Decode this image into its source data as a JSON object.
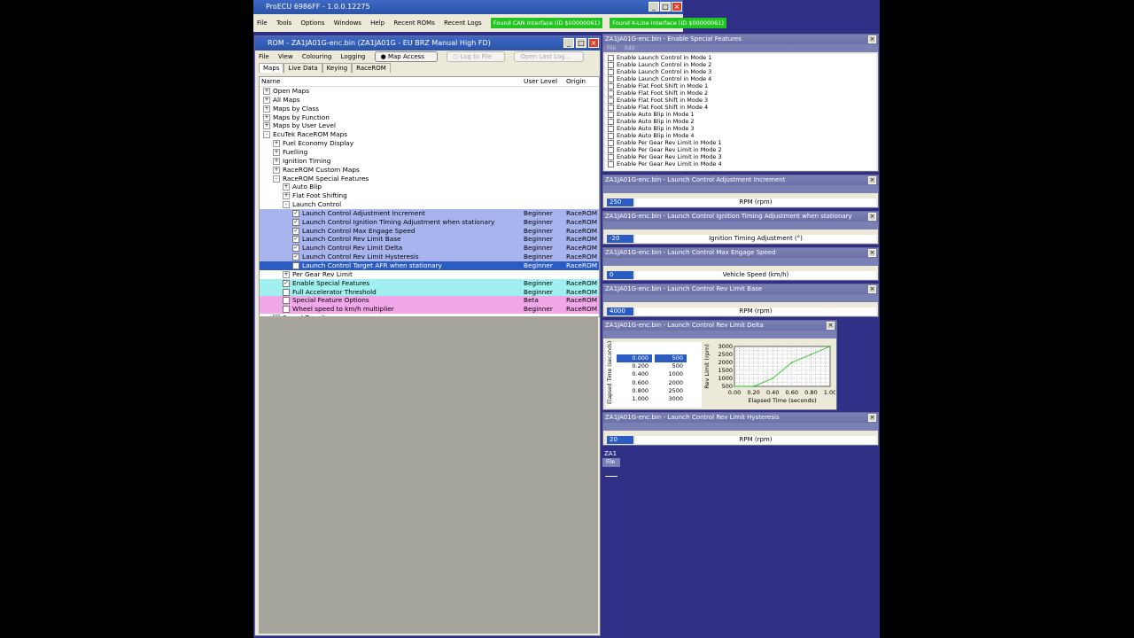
{
  "app": {
    "title": "ProECU 6986FF - 1.0.0.12275",
    "menu": [
      "File",
      "Tools",
      "Options",
      "Windows",
      "Help",
      "Recent ROMs",
      "Recent Logs"
    ],
    "status_can": "Found CAN Interface (ID $00000061)",
    "status_kline": "Found K-Line Interface (ID $00000061)"
  },
  "rom_window": {
    "title": "ROM - ZA1JA01G-enc.bin (ZA1JA01G - EU BRZ Manual High FD)",
    "menu": [
      "File",
      "View",
      "Colouring",
      "Logging"
    ],
    "buttons": {
      "map_access": "Map Access",
      "log_to_file": "Log to File",
      "open_last_log": "Open Last Log..."
    },
    "tabs": [
      "Maps",
      "Live Data",
      "Keying",
      "RaceROM"
    ],
    "columns": {
      "name": "Name",
      "level": "User Level",
      "origin": "Origin"
    },
    "tree": [
      {
        "label": "Open Maps",
        "indent": 0,
        "exp": "+"
      },
      {
        "label": "All Maps",
        "indent": 0,
        "exp": "+"
      },
      {
        "label": "Maps by Class",
        "indent": 0,
        "exp": "+"
      },
      {
        "label": "Maps by Function",
        "indent": 0,
        "exp": "+"
      },
      {
        "label": "Maps by User Level",
        "indent": 0,
        "exp": "+"
      },
      {
        "label": "EcuTek RaceROM Maps",
        "indent": 0,
        "exp": "-"
      },
      {
        "label": "Fuel Economy Display",
        "indent": 1,
        "exp": "+"
      },
      {
        "label": "Fuelling",
        "indent": 1,
        "exp": "+"
      },
      {
        "label": "Ignition Timing",
        "indent": 1,
        "exp": "+"
      },
      {
        "label": "RaceROM Custom Maps",
        "indent": 1,
        "exp": "+"
      },
      {
        "label": "RaceROM Special Features",
        "indent": 1,
        "exp": "-"
      },
      {
        "label": "Auto Blip",
        "indent": 2,
        "exp": "+"
      },
      {
        "label": "Flat Foot Shifting",
        "indent": 2,
        "exp": "+"
      },
      {
        "label": "Launch Control",
        "indent": 2,
        "exp": "-"
      },
      {
        "label": "Launch Control Adjustment Increment",
        "indent": 3,
        "cb": true,
        "level": "Beginner",
        "origin": "RaceROM",
        "hl": "blue"
      },
      {
        "label": "Launch Control Ignition Timing Adjustment when stationary",
        "indent": 3,
        "cb": true,
        "level": "Beginner",
        "origin": "RaceROM",
        "hl": "blue"
      },
      {
        "label": "Launch Control Max Engage Speed",
        "indent": 3,
        "cb": true,
        "level": "Beginner",
        "origin": "RaceROM",
        "hl": "blue"
      },
      {
        "label": "Launch Control Rev Limit Base",
        "indent": 3,
        "cb": true,
        "level": "Beginner",
        "origin": "RaceROM",
        "hl": "blue"
      },
      {
        "label": "Launch Control Rev Limit Delta",
        "indent": 3,
        "cb": true,
        "level": "Beginner",
        "origin": "RaceROM",
        "hl": "blue"
      },
      {
        "label": "Launch Control Rev Limit Hysteresis",
        "indent": 3,
        "cb": true,
        "level": "Beginner",
        "origin": "RaceROM",
        "hl": "blue"
      },
      {
        "label": "Launch Control Target AFR when stationary",
        "indent": 3,
        "cb": false,
        "level": "Beginner",
        "origin": "RaceROM",
        "hl": "sel"
      },
      {
        "label": "Per Gear Rev Limit",
        "indent": 2,
        "exp": "+"
      },
      {
        "label": "Enable Special Features",
        "indent": 2,
        "cb": true,
        "level": "Beginner",
        "origin": "RaceROM",
        "hl": "cyan"
      },
      {
        "label": "Full Accelerator Threshold",
        "indent": 2,
        "cb": false,
        "level": "Beginner",
        "origin": "RaceROM",
        "hl": "cyan"
      },
      {
        "label": "Special Feature Options",
        "indent": 2,
        "cb": false,
        "level": "Beta",
        "origin": "RaceROM",
        "hl": "pink"
      },
      {
        "label": "Wheel speed to km/h multiplier",
        "indent": 2,
        "cb": false,
        "level": "Beginner",
        "origin": "RaceROM",
        "hl": "pink"
      },
      {
        "label": "Speed Density",
        "indent": 1,
        "exp": "+"
      }
    ]
  },
  "features_panel": {
    "title": "ZA1JA01G-enc.bin - Enable Special Features",
    "menu": [
      "File",
      "Edit"
    ],
    "items": [
      "Enable Launch Control in Mode 1",
      "Enable Launch Control in Mode 2",
      "Enable Launch Control in Mode 3",
      "Enable Launch Control in Mode 4",
      "Enable Flat Foot Shift in Mode 1",
      "Enable Flat Foot Shift in Mode 2",
      "Enable Flat Foot Shift in Mode 3",
      "Enable Flat Foot Shift in Mode 4",
      "Enable Auto Blip in Mode 1",
      "Enable Auto Blip in Mode 2",
      "Enable Auto Blip in Mode 3",
      "Enable Auto Blip in Mode 4",
      "Enable Per Gear Rev Limit in Mode 1",
      "Enable Per Gear Rev Limit in Mode 2",
      "Enable Per Gear Rev Limit in Mode 3",
      "Enable Per Gear Rev Limit in Mode 4"
    ]
  },
  "value_panels": [
    {
      "title": "ZA1JA01G-enc.bin - Launch Control Adjustment Increment",
      "value": "250",
      "label": "RPM (rpm)"
    },
    {
      "title": "ZA1JA01G-enc.bin - Launch Control Ignition Timing Adjustment when stationary",
      "value": "-20",
      "label": "Ignition Timing Adjustment (°)"
    },
    {
      "title": "ZA1JA01G-enc.bin - Launch Control Max Engage Speed",
      "value": "0",
      "label": "Vehicle Speed (km/h)"
    },
    {
      "title": "ZA1JA01G-enc.bin - Launch Control Rev Limit Base",
      "value": "4000",
      "label": "RPM (rpm)"
    }
  ],
  "delta_panel": {
    "title": "ZA1JA01G-enc.bin - Launch Control Rev Limit Delta",
    "table_x": [
      "0.000",
      "0.200",
      "0.400",
      "0.600",
      "0.800",
      "1.000"
    ],
    "table_y": [
      "500",
      "500",
      "1000",
      "2000",
      "2500",
      "3000"
    ],
    "left_axis": "Elapsed Time (seconds)",
    "chart_ylabel": "Rev Limit (rpm)",
    "chart_xlabel": "Elapsed Time (seconds)",
    "y_ticks": [
      "3000",
      "2500",
      "2000",
      "1500",
      "1000",
      "500"
    ],
    "x_ticks": [
      "0.00",
      "0.20",
      "0.40",
      "0.60",
      "0.80",
      "1.00"
    ]
  },
  "hysteresis_panel": {
    "title": "ZA1JA01G-enc.bin - Launch Control Rev Limit Hysteresis",
    "value": "20",
    "label": "RPM (rpm)"
  },
  "mini_panel": {
    "title": "ZA1",
    "menu": "File"
  },
  "chart_data": {
    "type": "line",
    "x": [
      0.0,
      0.2,
      0.4,
      0.6,
      0.8,
      1.0
    ],
    "y": [
      500,
      500,
      1000,
      2000,
      2500,
      3000
    ],
    "xlabel": "Elapsed Time (seconds)",
    "ylabel": "Rev Limit (rpm)",
    "xlim": [
      0,
      1
    ],
    "ylim": [
      500,
      3000
    ],
    "grid": true,
    "color": "#22c422"
  }
}
